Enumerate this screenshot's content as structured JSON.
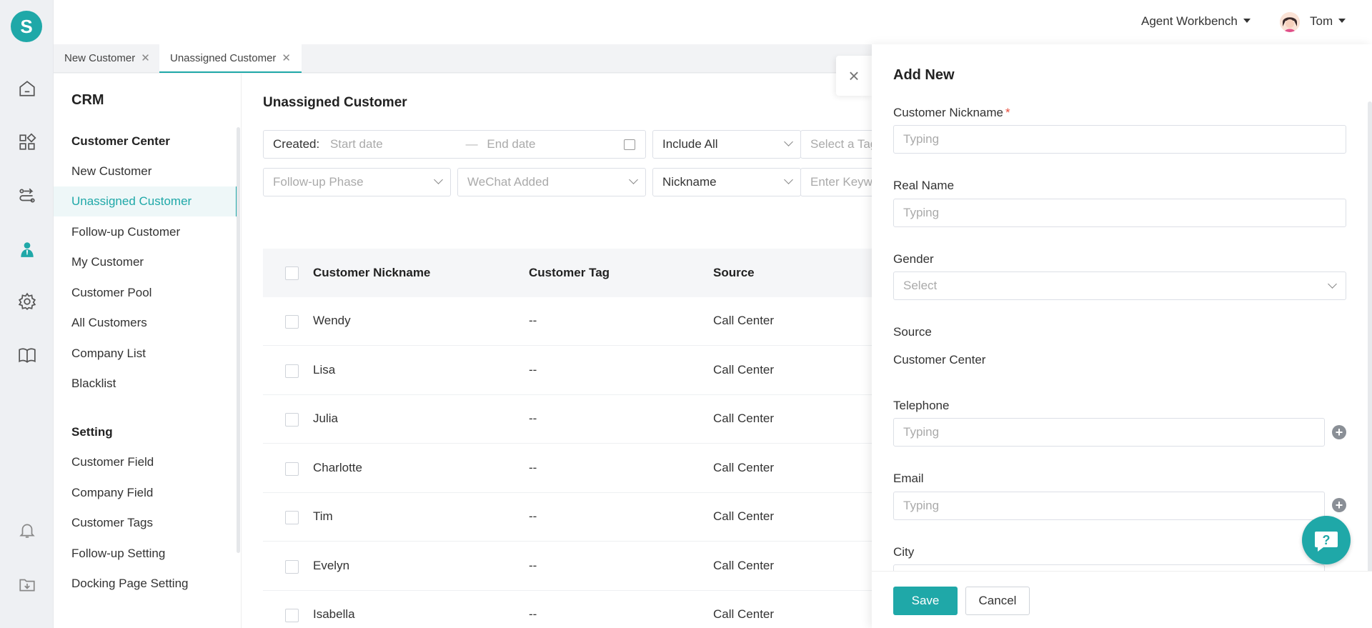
{
  "app": {
    "logo_letter": "S"
  },
  "header": {
    "workbench": "Agent Workbench",
    "user_name": "Tom"
  },
  "tabs": [
    {
      "label": "New Customer",
      "close": "✕"
    },
    {
      "label": "Unassigned Customer",
      "close": "✕"
    }
  ],
  "rail_icons": [
    "home-icon",
    "apps-icon",
    "route-icon",
    "customer-icon",
    "settings-gear-icon",
    "book-icon",
    "bell-icon",
    "download-icon"
  ],
  "sidebar": {
    "title": "CRM",
    "sections": [
      {
        "heading": "Customer Center",
        "items": [
          "New Customer",
          "Unassigned Customer",
          "Follow-up Customer",
          "My Customer",
          "Customer Pool",
          "All Customers",
          "Company List",
          "Blacklist"
        ]
      },
      {
        "heading": "Setting",
        "items": [
          "Customer Field",
          "Company Field",
          "Customer Tags",
          "Follow-up Setting",
          "Docking Page Setting"
        ]
      }
    ],
    "active_item": "Unassigned Customer"
  },
  "main": {
    "title": "Unassigned Customer",
    "filters": {
      "created_label": "Created:",
      "start_placeholder": "Start date",
      "range_sep": "—",
      "end_placeholder": "End date",
      "include": "Include All",
      "tag_placeholder": "Select a Tag",
      "phase_placeholder": "Follow-up Phase",
      "wechat_placeholder": "WeChat Added",
      "search_field": "Nickname",
      "keyword_placeholder": "Enter Keyword"
    },
    "table": {
      "columns": [
        "Customer Nickname",
        "Customer Tag",
        "Source"
      ],
      "rows": [
        [
          "Wendy",
          "--",
          "Call Center"
        ],
        [
          "Lisa",
          "--",
          "Call Center"
        ],
        [
          "Julia",
          "--",
          "Call Center"
        ],
        [
          "Charlotte",
          "--",
          "Call Center"
        ],
        [
          "Tim",
          "--",
          "Call Center"
        ],
        [
          "Evelyn",
          "--",
          "Call Center"
        ],
        [
          "Isabella",
          "--",
          "Call Center"
        ]
      ]
    }
  },
  "drawer": {
    "title": "Add New",
    "close": "×",
    "fields": {
      "nickname_label": "Customer Nickname",
      "required_mark": "*",
      "nickname_placeholder": "Typing",
      "realname_label": "Real Name",
      "realname_placeholder": "Typing",
      "gender_label": "Gender",
      "gender_placeholder": "Select",
      "source_label": "Source",
      "source_value": "Customer Center",
      "telephone_label": "Telephone",
      "telephone_placeholder": "Typing",
      "email_label": "Email",
      "email_placeholder": "Typing",
      "city_label": "City"
    },
    "plus": "+",
    "save": "Save",
    "cancel": "Cancel"
  },
  "colors": {
    "accent": "#1fa8a8",
    "required": "#e74c3c"
  }
}
